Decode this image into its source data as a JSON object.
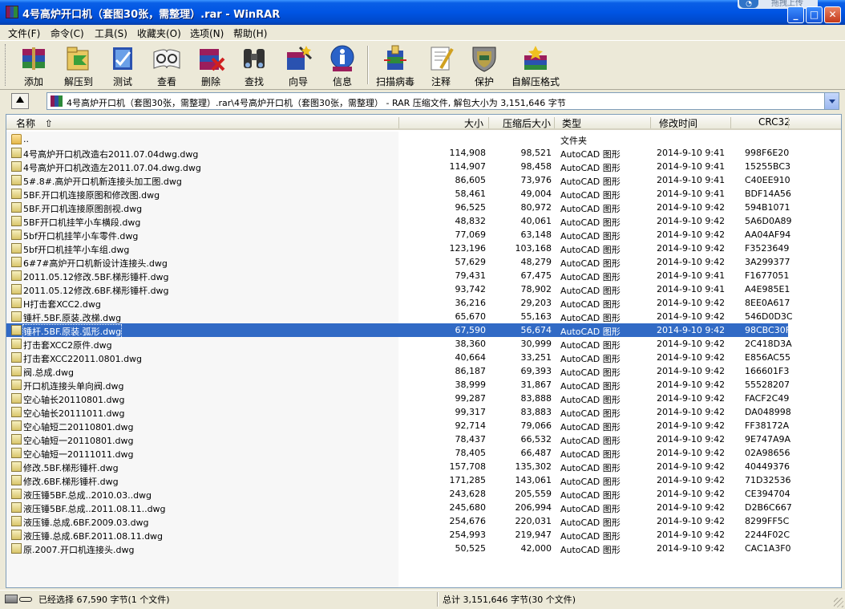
{
  "window": {
    "title": "4号高炉开口机（套图30张，需整理）.rar - WinRAR",
    "badge_text": "拖拽上传"
  },
  "menu": [
    "文件(F)",
    "命令(C)",
    "工具(S)",
    "收藏夹(O)",
    "选项(N)",
    "帮助(H)"
  ],
  "toolbar": [
    {
      "label": "添加",
      "icon": "add-archive-icon"
    },
    {
      "label": "解压到",
      "icon": "extract-to-icon"
    },
    {
      "label": "测试",
      "icon": "test-icon"
    },
    {
      "label": "查看",
      "icon": "view-icon"
    },
    {
      "label": "删除",
      "icon": "delete-icon"
    },
    {
      "label": "查找",
      "icon": "find-binoculars-icon"
    },
    {
      "label": "向导",
      "icon": "wizard-icon"
    },
    {
      "label": "信息",
      "icon": "info-icon"
    },
    {
      "label": "扫描病毒",
      "icon": "virus-scan-icon"
    },
    {
      "label": "注释",
      "icon": "comment-icon"
    },
    {
      "label": "保护",
      "icon": "protect-shield-icon"
    },
    {
      "label": "自解压格式",
      "icon": "sfx-icon"
    }
  ],
  "address": {
    "path": "4号高炉开口机（套图30张，需整理）.rar\\4号高炉开口机（套图30张，需整理） - RAR 压缩文件, 解包大小为 3,151,646 字节"
  },
  "columns": {
    "name": "名称",
    "size": "大小",
    "packed": "压缩后大小",
    "type": "类型",
    "modified": "修改时间",
    "crc": "CRC32"
  },
  "files": [
    {
      "name": "..",
      "size": "",
      "packed": "",
      "type": "文件夹",
      "modified": "",
      "crc": "",
      "folder": true
    },
    {
      "name": "4号高炉开口机改造右2011.07.04dwg.dwg",
      "size": "114,908",
      "packed": "98,521",
      "type": "AutoCAD 图形",
      "modified": "2014-9-10  9:41",
      "crc": "998F6E20"
    },
    {
      "name": "4号高炉开口机改造左2011.07.04.dwg.dwg",
      "size": "114,907",
      "packed": "98,458",
      "type": "AutoCAD 图形",
      "modified": "2014-9-10  9:41",
      "crc": "15255BC3"
    },
    {
      "name": "5#.8#.高炉开口机新连接头加工图.dwg",
      "size": "86,605",
      "packed": "73,976",
      "type": "AutoCAD 图形",
      "modified": "2014-9-10  9:41",
      "crc": "C40EE910"
    },
    {
      "name": "5BF.开口机连接原图和修改图.dwg",
      "size": "58,461",
      "packed": "49,004",
      "type": "AutoCAD 图形",
      "modified": "2014-9-10  9:41",
      "crc": "BDF14A56"
    },
    {
      "name": "5BF.开口机连接原图剖视.dwg",
      "size": "96,525",
      "packed": "80,972",
      "type": "AutoCAD 图形",
      "modified": "2014-9-10  9:42",
      "crc": "594B1071"
    },
    {
      "name": "5BF开口机挂竿小车横段.dwg",
      "size": "48,832",
      "packed": "40,061",
      "type": "AutoCAD 图形",
      "modified": "2014-9-10  9:42",
      "crc": "5A6D0A89"
    },
    {
      "name": "5bf开口机挂竿小车零件.dwg",
      "size": "77,069",
      "packed": "63,148",
      "type": "AutoCAD 图形",
      "modified": "2014-9-10  9:42",
      "crc": "AA04AF94"
    },
    {
      "name": "5bf开口机挂竿小车组.dwg",
      "size": "123,196",
      "packed": "103,168",
      "type": "AutoCAD 图形",
      "modified": "2014-9-10  9:42",
      "crc": "F3523649"
    },
    {
      "name": "6#7#高炉开口机新设计连接头.dwg",
      "size": "57,629",
      "packed": "48,279",
      "type": "AutoCAD 图形",
      "modified": "2014-9-10  9:42",
      "crc": "3A299377"
    },
    {
      "name": "2011.05.12修改.5BF.梯形锤杆.dwg",
      "size": "79,431",
      "packed": "67,475",
      "type": "AutoCAD 图形",
      "modified": "2014-9-10  9:41",
      "crc": "F1677051"
    },
    {
      "name": "2011.05.12修改.6BF.梯形锤杆.dwg",
      "size": "93,742",
      "packed": "78,902",
      "type": "AutoCAD 图形",
      "modified": "2014-9-10  9:41",
      "crc": "A4E985E1"
    },
    {
      "name": "H打击套XCC2.dwg",
      "size": "36,216",
      "packed": "29,203",
      "type": "AutoCAD 图形",
      "modified": "2014-9-10  9:42",
      "crc": "8EE0A617"
    },
    {
      "name": "锤杆.5BF.原装.改梯.dwg",
      "size": "65,670",
      "packed": "55,163",
      "type": "AutoCAD 图形",
      "modified": "2014-9-10  9:42",
      "crc": "546D0D3C"
    },
    {
      "name": "锤杆.5BF.原装.弧形.dwg",
      "size": "67,590",
      "packed": "56,674",
      "type": "AutoCAD 图形",
      "modified": "2014-9-10  9:42",
      "crc": "98CBC30F",
      "selected": true
    },
    {
      "name": "打击套XCC2原件.dwg",
      "size": "38,360",
      "packed": "30,999",
      "type": "AutoCAD 图形",
      "modified": "2014-9-10  9:42",
      "crc": "2C418D3A"
    },
    {
      "name": "打击套XCC22011.0801.dwg",
      "size": "40,664",
      "packed": "33,251",
      "type": "AutoCAD 图形",
      "modified": "2014-9-10  9:42",
      "crc": "E856AC55"
    },
    {
      "name": "阀.总成.dwg",
      "size": "86,187",
      "packed": "69,393",
      "type": "AutoCAD 图形",
      "modified": "2014-9-10  9:42",
      "crc": "166601F3"
    },
    {
      "name": "开口机连接头单向阀.dwg",
      "size": "38,999",
      "packed": "31,867",
      "type": "AutoCAD 图形",
      "modified": "2014-9-10  9:42",
      "crc": "55528207"
    },
    {
      "name": "空心轴长20110801.dwg",
      "size": "99,287",
      "packed": "83,888",
      "type": "AutoCAD 图形",
      "modified": "2014-9-10  9:42",
      "crc": "FACF2C49"
    },
    {
      "name": "空心轴长20111011.dwg",
      "size": "99,317",
      "packed": "83,883",
      "type": "AutoCAD 图形",
      "modified": "2014-9-10  9:42",
      "crc": "DA048998"
    },
    {
      "name": "空心轴短二20110801.dwg",
      "size": "92,714",
      "packed": "79,066",
      "type": "AutoCAD 图形",
      "modified": "2014-9-10  9:42",
      "crc": "FF38172A"
    },
    {
      "name": "空心轴短一20110801.dwg",
      "size": "78,437",
      "packed": "66,532",
      "type": "AutoCAD 图形",
      "modified": "2014-9-10  9:42",
      "crc": "9E747A9A"
    },
    {
      "name": "空心轴短一20111011.dwg",
      "size": "78,405",
      "packed": "66,487",
      "type": "AutoCAD 图形",
      "modified": "2014-9-10  9:42",
      "crc": "02A98656"
    },
    {
      "name": "修改.5BF.梯形锤杆.dwg",
      "size": "157,708",
      "packed": "135,302",
      "type": "AutoCAD 图形",
      "modified": "2014-9-10  9:42",
      "crc": "40449376"
    },
    {
      "name": "修改.6BF.梯形锤杆.dwg",
      "size": "171,285",
      "packed": "143,061",
      "type": "AutoCAD 图形",
      "modified": "2014-9-10  9:42",
      "crc": "71D32536"
    },
    {
      "name": "液压锤5BF.总成..2010.03..dwg",
      "size": "243,628",
      "packed": "205,559",
      "type": "AutoCAD 图形",
      "modified": "2014-9-10  9:42",
      "crc": "CE394704"
    },
    {
      "name": "液压锤5BF.总成..2011.08.11..dwg",
      "size": "245,680",
      "packed": "206,994",
      "type": "AutoCAD 图形",
      "modified": "2014-9-10  9:42",
      "crc": "D2B6C667"
    },
    {
      "name": "液压锤.总成.6BF.2009.03.dwg",
      "size": "254,676",
      "packed": "220,031",
      "type": "AutoCAD 图形",
      "modified": "2014-9-10  9:42",
      "crc": "8299FF5C"
    },
    {
      "name": "液压锤.总成.6BF.2011.08.11.dwg",
      "size": "254,993",
      "packed": "219,947",
      "type": "AutoCAD 图形",
      "modified": "2014-9-10  9:42",
      "crc": "2244F02C"
    },
    {
      "name": "原.2007.开口机连接头.dwg",
      "size": "50,525",
      "packed": "42,000",
      "type": "AutoCAD 图形",
      "modified": "2014-9-10  9:42",
      "crc": "CAC1A3F0"
    }
  ],
  "status": {
    "left": "已经选择 67,590 字节(1 个文件)",
    "right": "总计 3,151,646 字节(30 个文件)"
  },
  "colors": {
    "titlebar": "#0054e3",
    "selection": "#316ac5",
    "window_bg": "#ece9d8"
  }
}
